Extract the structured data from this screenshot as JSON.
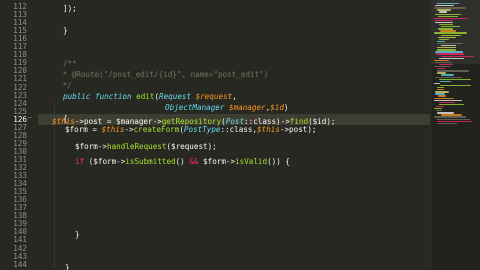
{
  "editor": {
    "line_numbers": [
      "112",
      "113",
      "114",
      "115",
      "116",
      "117",
      "118",
      "119",
      "120",
      "121",
      "122",
      "123",
      "124",
      "125",
      "126",
      "127",
      "128",
      "129",
      "130",
      "131",
      "132",
      "133",
      "134",
      "135",
      "136",
      "137",
      "138",
      "139",
      "140",
      "141",
      "142",
      "143",
      "144"
    ],
    "active_line": "126"
  },
  "code": {
    "l112": "]);",
    "l114": "}",
    "l119": "/**",
    "l120": " * @Route(\"/post_edit/{id}\", name=\"post_edit\")",
    "l121": " */",
    "l122_kw": "public function",
    "l122_fn": "edit",
    "l122_open": "(",
    "l122_type": "Request",
    "l122_var": "$request",
    "l122_comma": ",",
    "l123_type": "ObjectManager",
    "l123_var": "$manager",
    "l123_comma": ",",
    "l123_var2": "$id",
    "l123_close": ")",
    "l124": "{",
    "l125_this": "$this",
    "l125_a": "->post = $manager->",
    "l125_fn": "getRepository",
    "l125_b": "(",
    "l125_cls": "Post",
    "l125_c": "::class)->",
    "l125_fn2": "find",
    "l125_d": "($id);",
    "l126_a": "$form = ",
    "l126_this": "$this",
    "l126_b": "->",
    "l126_fn": "createForm",
    "l126_c": "(",
    "l126_cls": "PostType",
    "l126_d": "::class,",
    "l126_this2": "$this",
    "l126_e": "->post);",
    "l128_a": "$form->",
    "l128_fn": "handleRequest",
    "l128_b": "($request);",
    "l131_kw": "if",
    "l131_a": " ($form->",
    "l131_fn": "isSubmitted",
    "l131_b": "() ",
    "l131_op": "&&",
    "l131_c": " $form->",
    "l131_fn2": "isValid",
    "l131_d": "()) {",
    "l140": "}",
    "l144": "}"
  },
  "colors": {
    "background": "#272822",
    "keyword": "#66d9ef",
    "function": "#a6e22e",
    "variable": "#fd971f",
    "string": "#e6db74",
    "comment": "#75715e",
    "operator": "#f92672"
  }
}
